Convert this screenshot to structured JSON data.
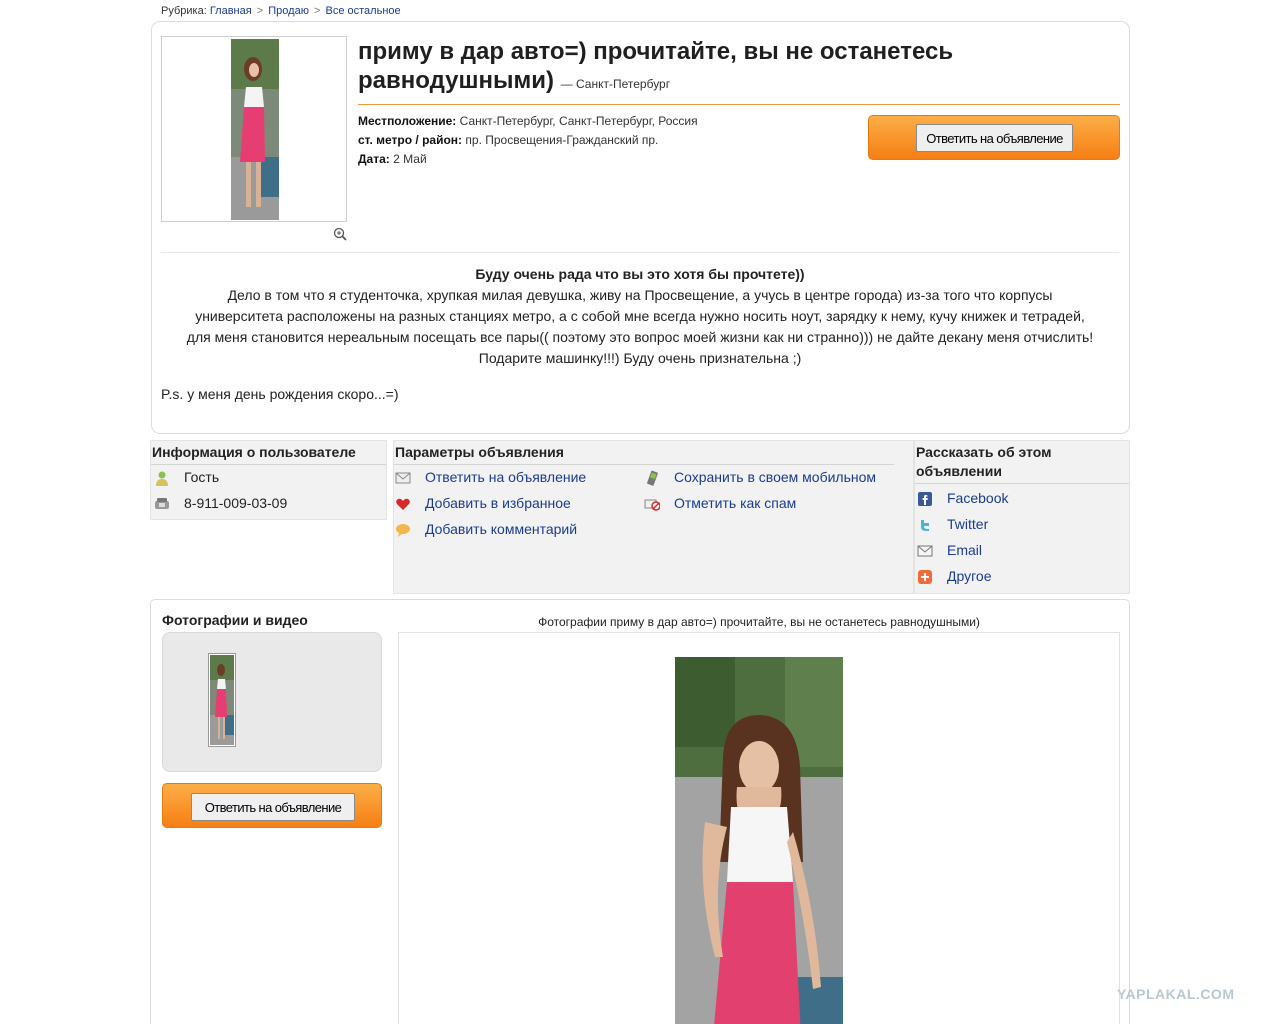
{
  "breadcrumb": {
    "prefix": "Рубрика:",
    "items": [
      {
        "label": "Главная"
      },
      {
        "label": "Продаю"
      },
      {
        "label": "Все остальное"
      }
    ],
    "separator": ">"
  },
  "listing": {
    "title": "приму в дар авто=) прочитайте, вы не останетесь равнодушными)",
    "city_suffix": "— Санкт-Петербург",
    "location_label": "Местположение:",
    "location_value": "Санкт-Петербург, Санкт-Петербург, Россия",
    "metro_label": "ст. метро / район:",
    "metro_value": "пр. Просвещения-Гражданский пр.",
    "date_label": "Дата:",
    "date_value": "2 Май",
    "reply_button": "Ответить на объявление"
  },
  "description": {
    "heading": "Буду очень рада что вы это хотя бы прочтете))",
    "line1": "Дело в том что я студенточка, хрупкая милая девушка, живу на Просвещение, а учусь в центре города) из-за того что корпусы",
    "line2": "университета расположены на разных станциях метро, а с собой мне всегда нужно носить ноут, зарядку к нему, кучу книжек и тетрадей,",
    "line3": "для меня становится нереальным посещать все пары(( поэтому это вопрос моей жизни как ни странно))) не дайте декану меня отчислить!",
    "line4": "Подарите машинку!!!) Буду очень признательна ;)",
    "ps": "P.s. у меня день рождения скоро...=)"
  },
  "user_info": {
    "heading": "Информация о пользователе",
    "name": "Гость",
    "phone": "8-911-009-03-09"
  },
  "params": {
    "heading": "Параметры объявления",
    "actions": [
      {
        "label": "Ответить на объявление",
        "icon": "envelope-icon"
      },
      {
        "label": "Добавить в избранное",
        "icon": "heart-icon"
      },
      {
        "label": "Добавить комментарий",
        "icon": "comment-icon"
      },
      {
        "label": "Сохранить в своем мобильном",
        "icon": "mobile-phone-icon"
      },
      {
        "label": "Отметить как спам",
        "icon": "spam-icon"
      }
    ]
  },
  "share": {
    "heading": "Рассказать об этом объявлении",
    "items": [
      {
        "label": "Facebook",
        "icon": "facebook-icon"
      },
      {
        "label": "Twitter",
        "icon": "twitter-icon"
      },
      {
        "label": "Email",
        "icon": "email-icon"
      },
      {
        "label": "Другое",
        "icon": "plus-icon"
      }
    ]
  },
  "photos": {
    "heading": "Фотографии и видео",
    "caption": "Фотографии приму в дар авто=) прочитайте, вы не останетесь равнодушными)",
    "reply_button": "Ответить на объявление"
  },
  "watermark": "YAPLAKAL.COM",
  "colors": {
    "accent_orange": "#f58a1f",
    "link_blue": "#1a3c8f",
    "panel_grey": "#f2f2f2"
  }
}
